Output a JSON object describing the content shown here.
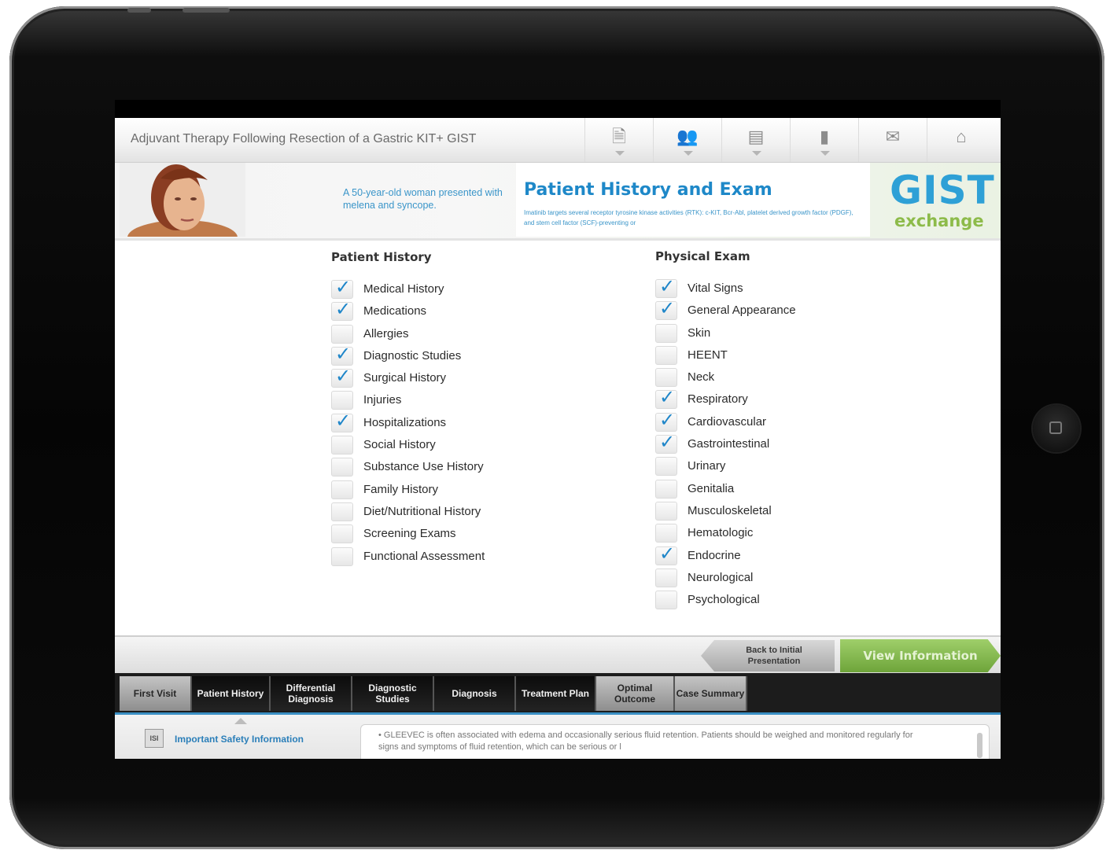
{
  "header": {
    "title": "Adjuvant Therapy Following Resection of a Gastric KIT+ GIST",
    "icons": [
      {
        "name": "pi-document-icon",
        "glyph": "🗎"
      },
      {
        "name": "people-icon",
        "glyph": "👥"
      },
      {
        "name": "id-card-icon",
        "glyph": "▤"
      },
      {
        "name": "book-icon",
        "glyph": "▮"
      },
      {
        "name": "mail-icon",
        "glyph": "✉"
      },
      {
        "name": "home-icon",
        "glyph": "⌂"
      }
    ]
  },
  "banner": {
    "note": "A 50-year-old woman presented with melena and syncope.",
    "heading": "Patient History and Exam",
    "subtext": "Imatinib targets several receptor tyrosine kinase activities (RTK): c-KIT, Bcr-Abl, platelet derived growth factor (PDGF), and stem cell factor (SCF)-preventing or",
    "logo_main": "GIST",
    "logo_sub": "exchange"
  },
  "patient_history": {
    "title": "Patient History",
    "items": [
      {
        "label": "Medical History",
        "checked": true
      },
      {
        "label": "Medications",
        "checked": true
      },
      {
        "label": "Allergies",
        "checked": false
      },
      {
        "label": "Diagnostic Studies",
        "checked": true
      },
      {
        "label": "Surgical History",
        "checked": true
      },
      {
        "label": "Injuries",
        "checked": false
      },
      {
        "label": "Hospitalizations",
        "checked": true
      },
      {
        "label": "Social History",
        "checked": false
      },
      {
        "label": "Substance Use History",
        "checked": false
      },
      {
        "label": "Family History",
        "checked": false
      },
      {
        "label": "Diet/Nutritional History",
        "checked": false
      },
      {
        "label": "Screening Exams",
        "checked": false
      },
      {
        "label": "Functional Assessment",
        "checked": false
      }
    ]
  },
  "physical_exam": {
    "title": "Physical Exam",
    "items": [
      {
        "label": "Vital Signs",
        "checked": true
      },
      {
        "label": "General Appearance",
        "checked": true
      },
      {
        "label": "Skin",
        "checked": false
      },
      {
        "label": "HEENT",
        "checked": false
      },
      {
        "label": "Neck",
        "checked": false
      },
      {
        "label": "Respiratory",
        "checked": true
      },
      {
        "label": "Cardiovascular",
        "checked": true
      },
      {
        "label": "Gastrointestinal",
        "checked": true
      },
      {
        "label": "Urinary",
        "checked": false
      },
      {
        "label": "Genitalia",
        "checked": false
      },
      {
        "label": "Musculoskeletal",
        "checked": false
      },
      {
        "label": "Hematologic",
        "checked": false
      },
      {
        "label": "Endocrine",
        "checked": true
      },
      {
        "label": "Neurological",
        "checked": false
      },
      {
        "label": "Psychological",
        "checked": false
      }
    ]
  },
  "actions": {
    "back": "Back to Initial Presentation",
    "view": "View Information"
  },
  "tabs": [
    {
      "label": "First Visit",
      "style": "gray"
    },
    {
      "label": "Patient History",
      "style": "dark"
    },
    {
      "label": "Differential Diagnosis",
      "style": "dark"
    },
    {
      "label": "Diagnostic Studies",
      "style": "dark"
    },
    {
      "label": "Diagnosis",
      "style": "dark"
    },
    {
      "label": "Treatment Plan",
      "style": "dark"
    },
    {
      "label": "Optimal Outcome",
      "style": "gray"
    },
    {
      "label": "Case Summary",
      "style": "gray"
    }
  ],
  "isi": {
    "icon_text": "ISI",
    "label": "Important Safety Information",
    "text": "• GLEEVEC is often associated with edema and occasionally serious fluid retention. Patients should be weighed and monitored regularly for signs and symptoms of fluid retention, which can be serious or l"
  },
  "colors": {
    "accent_blue": "#1e88c8",
    "check_blue": "#1f86c9",
    "logo_green": "#8dbb4a",
    "view_green": "#7ab043"
  }
}
